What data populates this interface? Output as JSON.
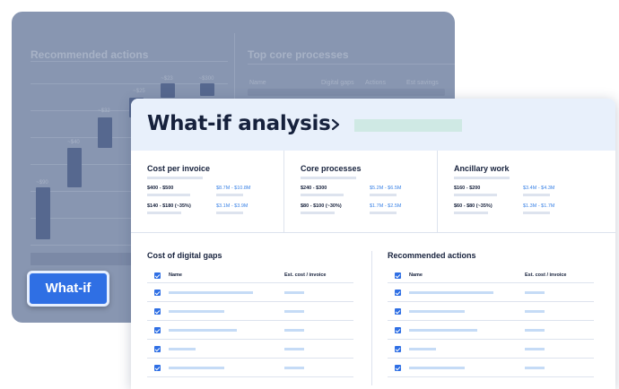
{
  "background": {
    "left_title": "Recommended actions",
    "right_title": "Top core processes",
    "columns": [
      "Name",
      "Digital gaps",
      "Actions",
      "Est savings"
    ],
    "waterfall_labels": [
      "~$90",
      "~$40",
      "~$32",
      "~$25",
      "~$23",
      "~$300"
    ],
    "whatif_button": "What-if"
  },
  "panel": {
    "title": "What-if analysis",
    "summary": [
      {
        "title": "Cost per invoice",
        "rows": [
          {
            "label": "$400 - $500",
            "value": "$8.7M - $10.8M"
          },
          {
            "label": "$140 - $180 (~35%)",
            "value": "$3.1M - $3.9M"
          }
        ]
      },
      {
        "title": "Core processes",
        "rows": [
          {
            "label": "$240 - $300",
            "value": "$5.2M - $6.5M"
          },
          {
            "label": "$80 - $100 (~30%)",
            "value": "$1.7M - $2.5M"
          }
        ]
      },
      {
        "title": "Ancillary work",
        "rows": [
          {
            "label": "$160 - $200",
            "value": "$3.4M - $4.3M"
          },
          {
            "label": "$60 - $80 (~35%)",
            "value": "$1.3M - $1.7M"
          }
        ]
      }
    ],
    "left_table": {
      "title": "Cost of digital gaps",
      "headers": [
        "Name",
        "Est. cost / invoice"
      ]
    },
    "right_table": {
      "title": "Recommended actions",
      "headers": [
        "Name",
        "Est. cost / invoice"
      ]
    }
  }
}
